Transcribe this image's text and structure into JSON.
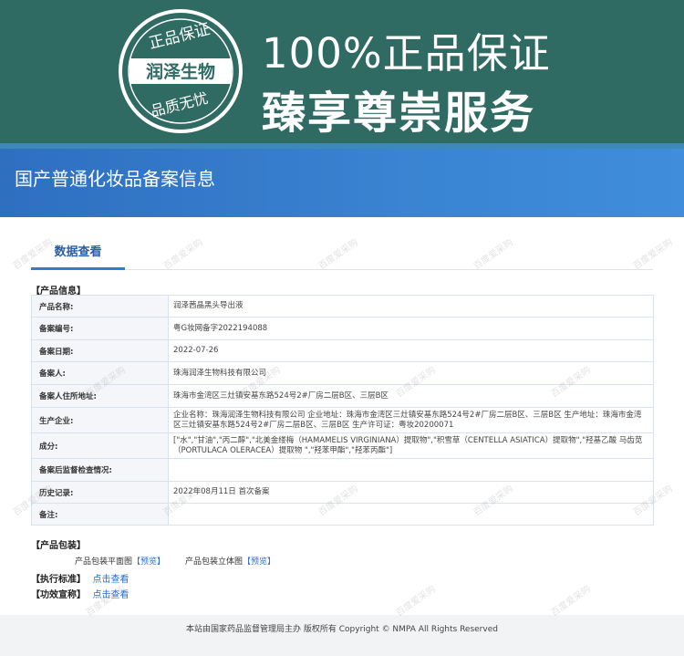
{
  "banner": {
    "seal": {
      "top_text": "正品保证",
      "middle_text": "润泽生物",
      "bottom_text": "品质无忧"
    },
    "title_line1": "100%正品保证",
    "title_line2": "臻享尊崇服务",
    "colors": {
      "banner_bg": "#2f6a63",
      "accent_line": "#3d8ab8"
    }
  },
  "header": {
    "title": "国产普通化妆品备案信息"
  },
  "tabs": [
    {
      "label": "数据查看",
      "active": true
    }
  ],
  "product_info": {
    "section_title": "【产品信息】",
    "rows": [
      {
        "key": "产品名称:",
        "value": "润泽茜晶黑头导出液"
      },
      {
        "key": "备案编号:",
        "value": "粤G妆网备字2022194088"
      },
      {
        "key": "备案日期:",
        "value": "2022-07-26"
      },
      {
        "key": "备案人:",
        "value": "珠海润泽生物科技有限公司"
      },
      {
        "key": "备案人住所地址:",
        "value": "珠海市金湾区三灶镇安基东路524号2#厂房二层B区、三层B区"
      },
      {
        "key": "生产企业:",
        "value": "企业名称：珠海润泽生物科技有限公司 企业地址：珠海市金湾区三灶镇安基东路524号2#厂房二层B区、三层B区 生产地址：珠海市金湾区三灶镇安基东路524号2#厂房二层B区、三层B区 生产许可证：粤妆20200071"
      },
      {
        "key": "成分:",
        "value": "[\"水\",\"甘油\",\"丙二醇\",\"北美金缕梅（HAMAMELIS VIRGINIANA）提取物\",\"积雪草（CENTELLA ASIATICA）提取物\",\"羟基乙酸 马齿苋（PORTULACA OLERACEA）提取物 \",\"羟苯甲酯\",\"羟苯丙酯\"]"
      },
      {
        "key": "备案后监督检查情况:",
        "value": ""
      },
      {
        "key": "历史记录:",
        "value": "2022年08月11日 首次备案"
      },
      {
        "key": "备注:",
        "value": ""
      }
    ]
  },
  "packaging": {
    "section_title": "【产品包装】",
    "flat_label": "产品包装平面图",
    "flat_link": "【预览】",
    "stereo_label": "产品包装立体图",
    "stereo_link": "【预览】"
  },
  "standard": {
    "section_title": "【执行标准】",
    "link": "点击查看"
  },
  "efficacy": {
    "section_title": "【功效宣称】",
    "link": "点击查看"
  },
  "footer": {
    "text": "本站由国家药品监督管理局主办 版权所有 Copyright © NMPA All Rights Reserved"
  },
  "watermark": {
    "text": "百度爱采购"
  }
}
